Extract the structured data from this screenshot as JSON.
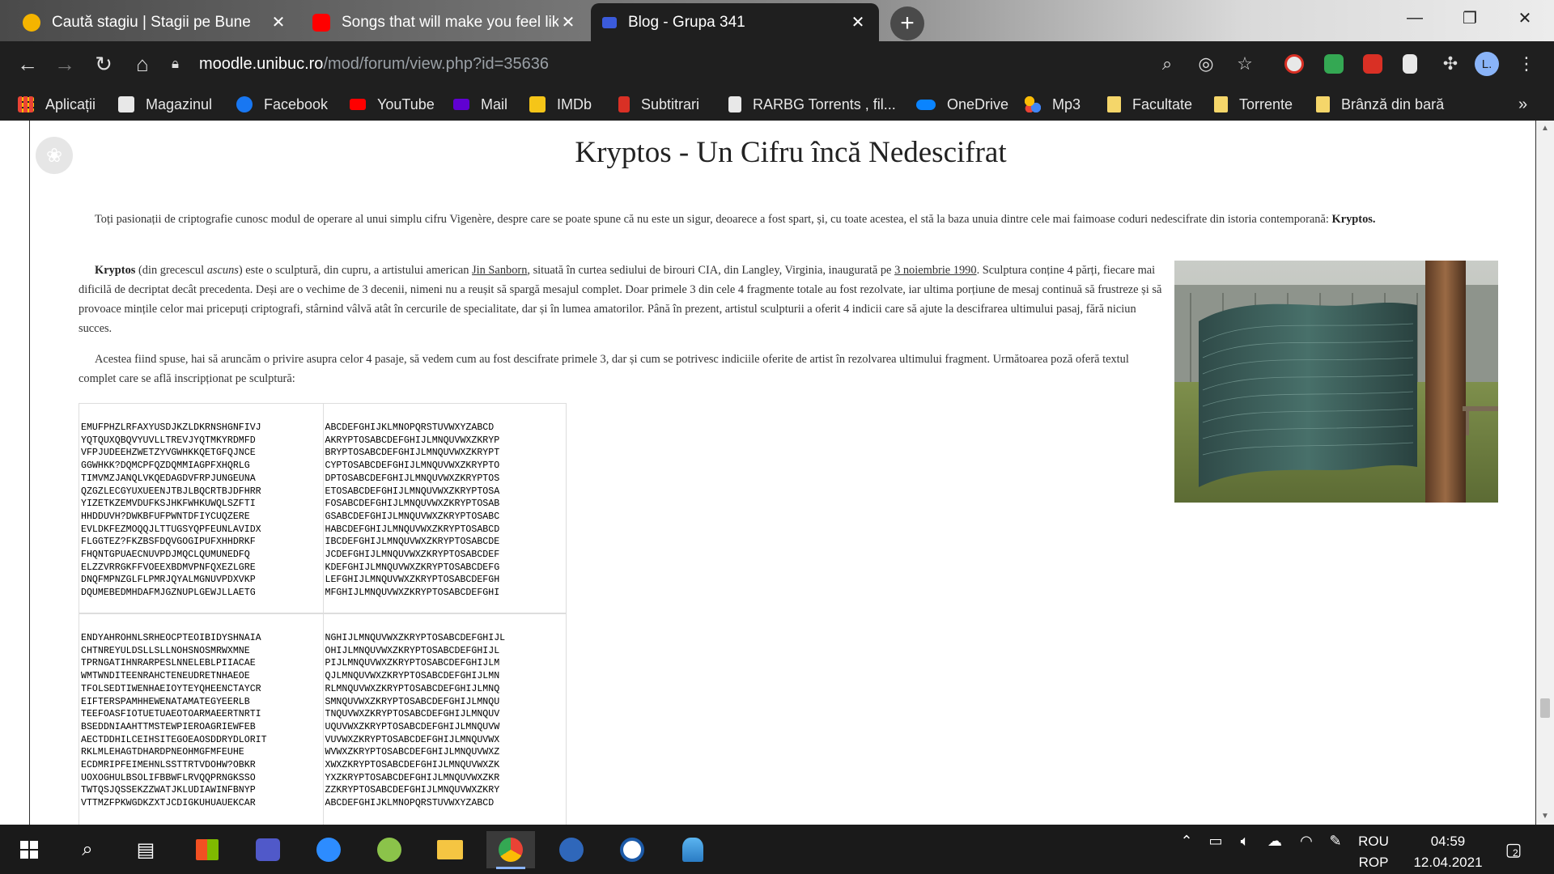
{
  "browser": {
    "tabs": [
      {
        "label": "Caută stagiu | Stagii pe Bune",
        "favicon_color": "#f4b400",
        "active": false
      },
      {
        "label": "Songs that will make you feel like",
        "favicon_color": "#ff0000",
        "active": false
      },
      {
        "label": "Blog - Grupa 341",
        "favicon_color": "#3b5bdb",
        "active": true
      }
    ],
    "new_tab_glyph": "+",
    "window_controls": {
      "minimize": "—",
      "restore": "❐",
      "close": "✕"
    },
    "address": {
      "host": "moodle.unibuc.ro",
      "path": "/mod/forum/view.php?id=35636"
    },
    "bookmarks": [
      {
        "label": "Aplicații",
        "icon": "apps-grid-icon",
        "color": "#ea4335"
      },
      {
        "label": "Magazinul",
        "icon": "webstore-icon",
        "color": "#e8e8e8"
      },
      {
        "label": "Facebook",
        "icon": "facebook-icon",
        "color": "#1877f2"
      },
      {
        "label": "YouTube",
        "icon": "youtube-icon",
        "color": "#ff0000"
      },
      {
        "label": "Mail",
        "icon": "mail-icon",
        "color": "#6001d2"
      },
      {
        "label": "IMDb",
        "icon": "imdb-icon",
        "color": "#f5c518"
      },
      {
        "label": "Subtitrari",
        "icon": "subtitrari-icon",
        "color": "#d93025"
      },
      {
        "label": "RARBG Torrents , fil...",
        "icon": "rarbg-icon",
        "color": "#e8e8e8"
      },
      {
        "label": "OneDrive",
        "icon": "onedrive-icon",
        "color": "#0a84ff"
      },
      {
        "label": "Mp3",
        "icon": "mp3-icon",
        "color": "#34a853"
      },
      {
        "label": "Facultate",
        "icon": "folder-icon",
        "color": "#f5d66a"
      },
      {
        "label": "Torrente",
        "icon": "folder-icon",
        "color": "#f5d66a"
      },
      {
        "label": "Brânză din bară",
        "icon": "folder-icon",
        "color": "#f5d66a"
      }
    ],
    "bookmarks_overflow": "»"
  },
  "article": {
    "title": "Kryptos - Un Cifru încă Nedescifrat",
    "p1": "Toți pasionații de criptografie cunosc modul de operare al unui simplu cifru Vigenère, despre care se poate spune că nu este un sigur, deoarece a fost spart, și, cu toate acestea, el stă la baza unuia dintre cele mai faimoase coduri nedescifrate din istoria contemporană:",
    "p1_bold": "Kryptos.",
    "p2_bold": "Kryptos",
    "p2_a": "(din grecescul",
    "p2_italic": "ascuns",
    "p2_b": ") este o sculptură, din cupru, a artistului american",
    "p2_link1": "Jin Sanborn",
    "p2_c": ", situată în curtea sediului de birouri CIA, din Langley, Virginia, inaugurată pe",
    "p2_link2": "3 noiembrie 1990",
    "p2_d": ". Sculptura conține 4 părți, fiecare mai dificilă de decriptat decât precedenta. Deși are o vechime de 3 decenii, nimeni nu a reușit să spargă mesajul complet. Doar primele 3 din cele 4 fragmente totale au fost rezolvate, iar ultima porțiune de mesaj continuă să frustreze și să provoace mințile celor mai pricepuți criptografi, stârnind vâlvă atât în cercurile de specialitate, dar și în lumea amatorilor. Până în prezent, artistul sculpturii a oferit 4 indicii care să ajute la descifrarea ultimului pasaj, fără niciun succes.",
    "p3": "Acestea fiind spuse, hai să aruncăm o privire asupra celor 4 pasaje, să vedem cum au fost descifrate primele 3, dar și cum se potrivesc indiciile oferite de artist în rezolvarea ultimului fragment. Următoarea poză oferă textul complet care se află inscripționat pe sculptură:",
    "cipher_block_1_left": "EMUFPHZLRFAXYUSDJKZLDKRNSHGNFIVJ\nYQTQUXQBQVYUVLLTREVJYQTMKYRDMFD\nVFPJUDEEHZWETZYVGWHKKQETGFQJNCE\nGGWHKK?DQMCPFQZDQMMIAGPFXHQRLG\nTIMVMZJANQLVKQEDAGDVFRPJUNGEUNA\nQZGZLECGYUXUEENJTBJLBQCRTBJDFHRR\nYIZETKZEMVDUFKSJHKFWHKUWQLSZFTI\nHHDDUVH?DWKBFUFPWNTDFIYCUQZERE\nEVLDKFEZMOQQJLTTUGSYQPFEUNLAVIDX\nFLGGTEZ?FKZBSFDQVGOGIPUFXHHDRKF\nFHQNTGPUAECNUVPDJMQCLQUMUNEDFQ\nELZZVRRGKFFVOEEXBDMVPNFQXEZLGRE\nDNQFMPNZGLFLPMRJQYALMGNUVPDXVKP\nDQUMEBEDMHDAFMJGZNUPLGEWJLLAETG",
    "cipher_block_1_right": "ABCDEFGHIJKLMNOPQRSTUVWXYZABCD\nAKRYPTOSABCDEFGHIJLMNQUVWXZKRYP\nBRYPTOSABCDEFGHIJLMNQUVWXZKRYPT\nCYPTOSABCDEFGHIJLMNQUVWXZKRYPTO\nDPTOSABCDEFGHIJLMNQUVWXZKRYPTOS\nETOSABCDEFGHIJLMNQUVWXZKRYPTOSA\nFOSABCDEFGHIJLMNQUVWXZKRYPTOSAB\nGSABCDEFGHIJLMNQUVWXZKRYPTOSABC\nHABCDEFGHIJLMNQUVWXZKRYPTOSABCD\nIBCDEFGHIJLMNQUVWXZKRYPTOSABCDE\nJCDEFGHIJLMNQUVWXZKRYPTOSABCDEF\nKDEFGHIJLMNQUVWXZKRYPTOSABCDEFG\nLEFGHIJLMNQUVWXZKRYPTOSABCDEFGH\nMFGHIJLMNQUVWXZKRYPTOSABCDEFGHI",
    "cipher_block_2_left": "ENDYAHROHNLSRHEOCPTEOIBIDYSHNAIA\nCHTNREYULDSLLSLLNOHSNOSMRWXMNE\nTPRNGATIHNRARPESLNNELEBLPIIACAE\nWMTWNDITEENRAHCTENEUDRETNHAEOE\nTFOLSEDTIWENHAEIOYTEYQHEENCTAYCR\nEIFTERSPAMHHEWENATAMATEGYEERLB\nTEEFOASFIOTUETUAEOTOARMAEERTNRTI\nBSEDDNIAAHTTMSTEWPIEROAGRIEWFEB\nAECTDDHILCEIHSITEGOEAOSDDRYDLORIT\nRKLMLEHAGTDHARDPNEOHMGFMFEUHE\nECDMRIPFEIMEHNLSSTTRTVDOHW?OBKR\nUOXOGHULBSOLIFBBWFLRVQQPRNGKSSO\nTWTQSJQSSEKZZWATJKLUDIAWINFBNYP\nVTTMZFPKWGDKZXTJCDIGKUHUAUEKCAR",
    "cipher_block_2_right": "NGHIJLMNQUVWXZKRYPTOSABCDEFGHIJL\nOHIJLMNQUVWXZKRYPTOSABCDEFGHIJL\nPIJLMNQUVWXZKRYPTOSABCDEFGHIJLM\nQJLMNQUVWXZKRYPTOSABCDEFGHIJLMN\nRLMNQUVWXZKRYPTOSABCDEFGHIJLMNQ\nSMNQUVWXZKRYPTOSABCDEFGHIJLMNQU\nTNQUVWXZKRYPTOSABCDEFGHIJLMNQUV\nUQUVWXZKRYPTOSABCDEFGHIJLMNQUVW\nVUVWXZKRYPTOSABCDEFGHIJLMNQUVWX\nWVWXZKRYPTOSABCDEFGHIJLMNQUVWXZ\nXWXZKRYPTOSABCDEFGHIJLMNQUVWXZK\nYXZKRYPTOSABCDEFGHIJLMNQUVWXZKR\nZZKRYPTOSABCDEFGHIJLMNQUVWXZKRY\nABCDEFGHIJKLMNOPQRSTUVWXYZABCD"
  },
  "taskbar": {
    "lang_top": "ROU",
    "lang_bottom": "ROP",
    "time": "04:59",
    "date": "12.04.2021",
    "notification_count": "2"
  }
}
